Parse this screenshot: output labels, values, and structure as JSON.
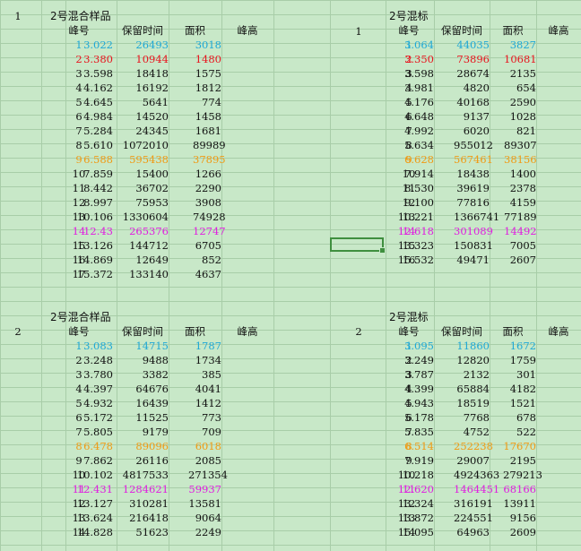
{
  "colors": {
    "cyan": "#1ea8d6",
    "red": "#e8141e",
    "orange": "#f09a14",
    "magenta": "#e01ee0",
    "black": "#111111"
  },
  "blocks": [
    {
      "group": "1",
      "title": "2号混合样品",
      "headers": [
        "峰号",
        "保留时间",
        "面积",
        "峰高"
      ],
      "rows": [
        {
          "c": [
            "1",
            "3.022",
            "26493",
            "3018"
          ],
          "color": "cyan"
        },
        {
          "c": [
            "2",
            "3.380",
            "10944",
            "1480"
          ],
          "color": "red"
        },
        {
          "c": [
            "3",
            "3.598",
            "18418",
            "1575"
          ],
          "color": "black"
        },
        {
          "c": [
            "4",
            "4.162",
            "16192",
            "1812"
          ],
          "color": "black"
        },
        {
          "c": [
            "5",
            "4.645",
            "5641",
            "774"
          ],
          "color": "black"
        },
        {
          "c": [
            "6",
            "4.984",
            "14520",
            "1458"
          ],
          "color": "black"
        },
        {
          "c": [
            "7",
            "5.284",
            "24345",
            "1681"
          ],
          "color": "black"
        },
        {
          "c": [
            "8",
            "5.610",
            "1072010",
            "89989"
          ],
          "color": "black"
        },
        {
          "c": [
            "9",
            "6.588",
            "595438",
            "37895"
          ],
          "color": "orange"
        },
        {
          "c": [
            "10",
            "7.859",
            "15400",
            "1266"
          ],
          "color": "black"
        },
        {
          "c": [
            "11",
            "8.442",
            "36702",
            "2290"
          ],
          "color": "black"
        },
        {
          "c": [
            "12",
            "8.997",
            "75953",
            "3908"
          ],
          "color": "black"
        },
        {
          "c": [
            "13",
            "10.106",
            "1330604",
            "74928"
          ],
          "color": "black"
        },
        {
          "c": [
            "14",
            "12.43",
            "265376",
            "12747"
          ],
          "color": "magenta"
        },
        {
          "c": [
            "15",
            "13.126",
            "144712",
            "6705"
          ],
          "color": "black"
        },
        {
          "c": [
            "16",
            "14.869",
            "12649",
            "852"
          ],
          "color": "black"
        },
        {
          "c": [
            "17",
            "15.372",
            "133140",
            "4637"
          ],
          "color": "black"
        }
      ]
    },
    {
      "group": "1",
      "title": "2号混标",
      "headers": [
        "峰号",
        "保留时间",
        "面积",
        "峰高"
      ],
      "rows": [
        {
          "c": [
            "1",
            "3.064",
            "44035",
            "3827"
          ],
          "color": "cyan"
        },
        {
          "c": [
            "2",
            "3.350",
            "73896",
            "10681"
          ],
          "color": "red"
        },
        {
          "c": [
            "3",
            "3.598",
            "28674",
            "2135"
          ],
          "color": "black"
        },
        {
          "c": [
            "4",
            "3.981",
            "4820",
            "654"
          ],
          "color": "black"
        },
        {
          "c": [
            "5",
            "4.176",
            "40168",
            "2590"
          ],
          "color": "black"
        },
        {
          "c": [
            "6",
            "4.648",
            "9137",
            "1028"
          ],
          "color": "black"
        },
        {
          "c": [
            "7",
            "4.992",
            "6020",
            "821"
          ],
          "color": "black"
        },
        {
          "c": [
            "8",
            "5.634",
            "955012",
            "89307"
          ],
          "color": "black"
        },
        {
          "c": [
            "9",
            "6.628",
            "567461",
            "38156"
          ],
          "color": "orange"
        },
        {
          "c": [
            "10",
            "7.914",
            "18438",
            "1400"
          ],
          "color": "black"
        },
        {
          "c": [
            "11",
            "8.530",
            "39619",
            "2378"
          ],
          "color": "black"
        },
        {
          "c": [
            "12",
            "9.100",
            "77816",
            "4159"
          ],
          "color": "black"
        },
        {
          "c": [
            "13",
            "10.221",
            "1366741",
            "77189"
          ],
          "color": "black"
        },
        {
          "c": [
            "14",
            "12.618",
            "301089",
            "14492"
          ],
          "color": "magenta"
        },
        {
          "c": [
            "15",
            "13.323",
            "150831",
            "7005"
          ],
          "color": "black"
        },
        {
          "c": [
            "16",
            "15.532",
            "49471",
            "2607"
          ],
          "color": "black"
        }
      ]
    },
    {
      "group": "2",
      "title": "2号混合样品",
      "headers": [
        "峰号",
        "保留时间",
        "面积",
        "峰高"
      ],
      "rows": [
        {
          "c": [
            "1",
            "3.083",
            "14715",
            "1787"
          ],
          "color": "cyan"
        },
        {
          "c": [
            "2",
            "3.248",
            "9488",
            "1734"
          ],
          "color": "black"
        },
        {
          "c": [
            "3",
            "3.780",
            "3382",
            "385"
          ],
          "color": "black"
        },
        {
          "c": [
            "4",
            "4.397",
            "64676",
            "4041"
          ],
          "color": "black"
        },
        {
          "c": [
            "5",
            "4.932",
            "16439",
            "1412"
          ],
          "color": "black"
        },
        {
          "c": [
            "6",
            "5.172",
            "11525",
            "773"
          ],
          "color": "black"
        },
        {
          "c": [
            "7",
            "5.805",
            "9179",
            "709"
          ],
          "color": "black"
        },
        {
          "c": [
            "8",
            "6.478",
            "89096",
            "6018"
          ],
          "color": "orange"
        },
        {
          "c": [
            "9",
            "7.862",
            "26116",
            "2085"
          ],
          "color": "black"
        },
        {
          "c": [
            "10",
            "10.102",
            "4817533",
            "271354"
          ],
          "color": "black"
        },
        {
          "c": [
            "11",
            "12.431",
            "1284621",
            "59937"
          ],
          "color": "magenta"
        },
        {
          "c": [
            "12",
            "13.127",
            "310281",
            "13581"
          ],
          "color": "black"
        },
        {
          "c": [
            "13",
            "13.624",
            "216418",
            "9064"
          ],
          "color": "black"
        },
        {
          "c": [
            "14",
            "14.828",
            "51623",
            "2249"
          ],
          "color": "black"
        }
      ]
    },
    {
      "group": "2",
      "title": "2号混标",
      "headers": [
        "峰号",
        "保留时间",
        "面积",
        "峰高"
      ],
      "rows": [
        {
          "c": [
            "1",
            "3.095",
            "11860",
            "1672"
          ],
          "color": "cyan"
        },
        {
          "c": [
            "2",
            "3.249",
            "12820",
            "1759"
          ],
          "color": "black"
        },
        {
          "c": [
            "3",
            "3.787",
            "2132",
            "301"
          ],
          "color": "black"
        },
        {
          "c": [
            "4",
            "4.399",
            "65884",
            "4182"
          ],
          "color": "black"
        },
        {
          "c": [
            "5",
            "4.943",
            "18519",
            "1521"
          ],
          "color": "black"
        },
        {
          "c": [
            "6",
            "5.178",
            "7768",
            "678"
          ],
          "color": "black"
        },
        {
          "c": [
            "7",
            "5.835",
            "4752",
            "522"
          ],
          "color": "black"
        },
        {
          "c": [
            "8",
            "6.514",
            "252238",
            "17670"
          ],
          "color": "orange"
        },
        {
          "c": [
            "9",
            "7.919",
            "29007",
            "2195"
          ],
          "color": "black"
        },
        {
          "c": [
            "10",
            "10.218",
            "4924363",
            "279213"
          ],
          "color": "black"
        },
        {
          "c": [
            "11",
            "12.620",
            "1464451",
            "68166"
          ],
          "color": "magenta"
        },
        {
          "c": [
            "12",
            "13.324",
            "316191",
            "13911"
          ],
          "color": "black"
        },
        {
          "c": [
            "13",
            "13.872",
            "224551",
            "9156"
          ],
          "color": "black"
        },
        {
          "c": [
            "14",
            "15.095",
            "64963",
            "2609"
          ],
          "color": "black"
        }
      ]
    }
  ]
}
